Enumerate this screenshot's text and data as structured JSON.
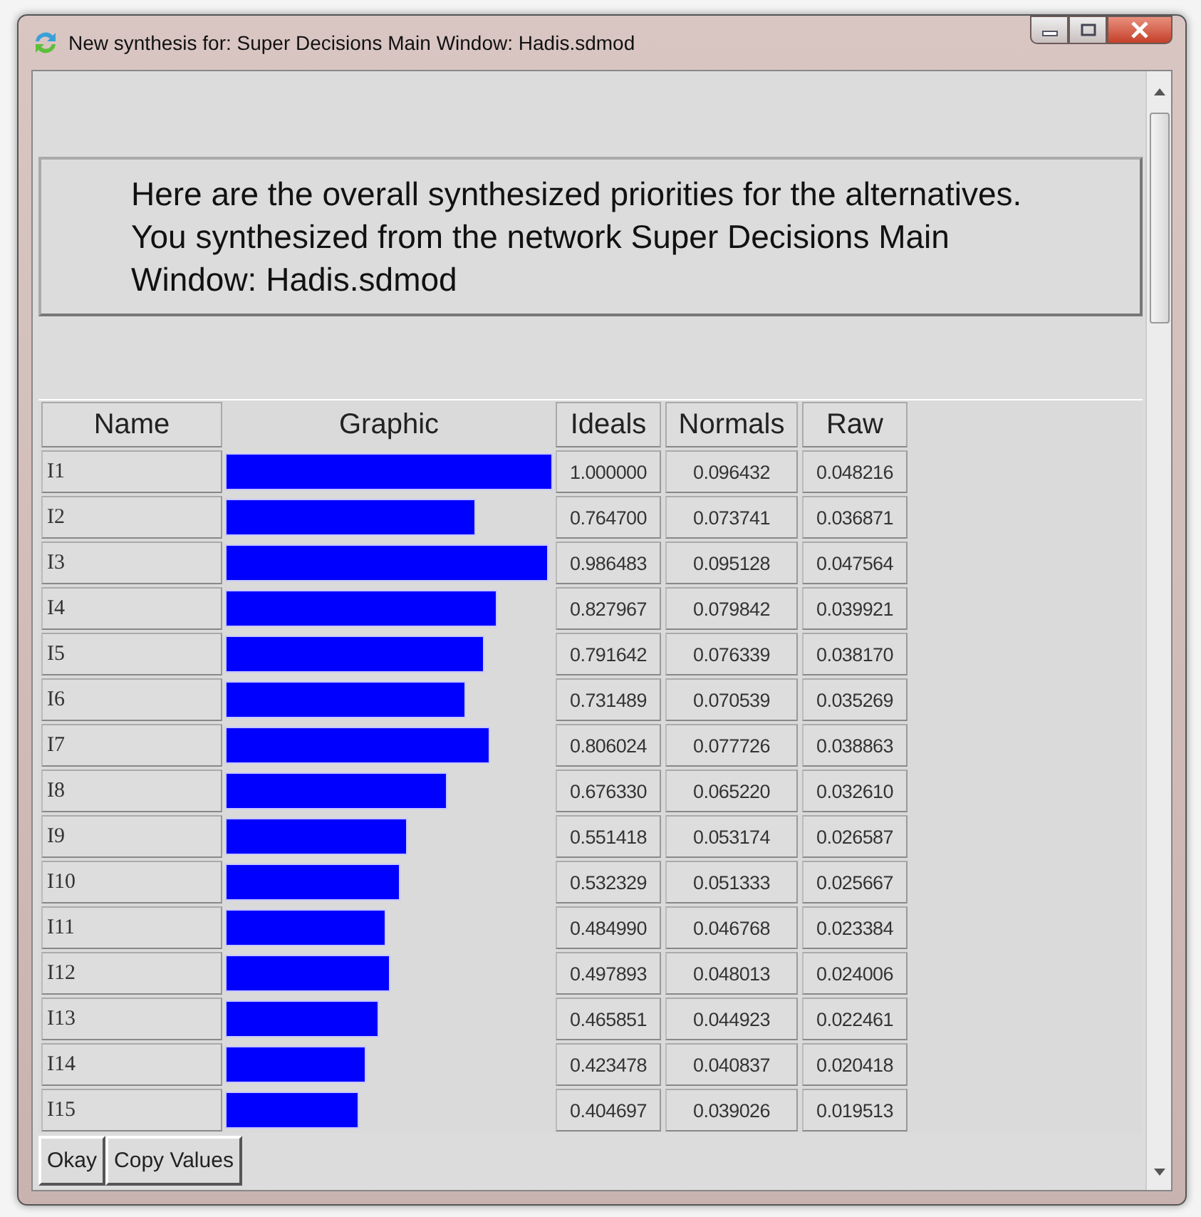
{
  "window": {
    "title": "New synthesis for: Super Decisions Main Window: Hadis.sdmod"
  },
  "message": "Here are the overall synthesized priorities for the alternatives.  You synthesized from the network Super Decisions Main Window: Hadis.sdmod",
  "table": {
    "columns": [
      "Name",
      "Graphic",
      "Ideals",
      "Normals",
      "Raw"
    ],
    "rows": [
      {
        "name": "I1",
        "level": 1.0,
        "ideals": "1.000000",
        "normals": "0.096432",
        "raw": "0.048216"
      },
      {
        "name": "I2",
        "level": 0.7647,
        "ideals": "0.764700",
        "normals": "0.073741",
        "raw": "0.036871"
      },
      {
        "name": "I3",
        "level": 0.986483,
        "ideals": "0.986483",
        "normals": "0.095128",
        "raw": "0.047564"
      },
      {
        "name": "I4",
        "level": 0.827967,
        "ideals": "0.827967",
        "normals": "0.079842",
        "raw": "0.039921"
      },
      {
        "name": "I5",
        "level": 0.791642,
        "ideals": "0.791642",
        "normals": "0.076339",
        "raw": "0.038170"
      },
      {
        "name": "I6",
        "level": 0.731489,
        "ideals": "0.731489",
        "normals": "0.070539",
        "raw": "0.035269"
      },
      {
        "name": "I7",
        "level": 0.806024,
        "ideals": "0.806024",
        "normals": "0.077726",
        "raw": "0.038863"
      },
      {
        "name": "I8",
        "level": 0.67633,
        "ideals": "0.676330",
        "normals": "0.065220",
        "raw": "0.032610"
      },
      {
        "name": "I9",
        "level": 0.551418,
        "ideals": "0.551418",
        "normals": "0.053174",
        "raw": "0.026587"
      },
      {
        "name": "I10",
        "level": 0.532329,
        "ideals": "0.532329",
        "normals": "0.051333",
        "raw": "0.025667"
      },
      {
        "name": "I11",
        "level": 0.48499,
        "ideals": "0.484990",
        "normals": "0.046768",
        "raw": "0.023384"
      },
      {
        "name": "I12",
        "level": 0.497893,
        "ideals": "0.497893",
        "normals": "0.048013",
        "raw": "0.024006"
      },
      {
        "name": "I13",
        "level": 0.465851,
        "ideals": "0.465851",
        "normals": "0.044923",
        "raw": "0.022461"
      },
      {
        "name": "I14",
        "level": 0.423478,
        "ideals": "0.423478",
        "normals": "0.040837",
        "raw": "0.020418"
      },
      {
        "name": "I15",
        "level": 0.404697,
        "ideals": "0.404697",
        "normals": "0.039026",
        "raw": "0.019513"
      }
    ]
  },
  "buttons": [
    "Okay",
    "Copy Values"
  ]
}
